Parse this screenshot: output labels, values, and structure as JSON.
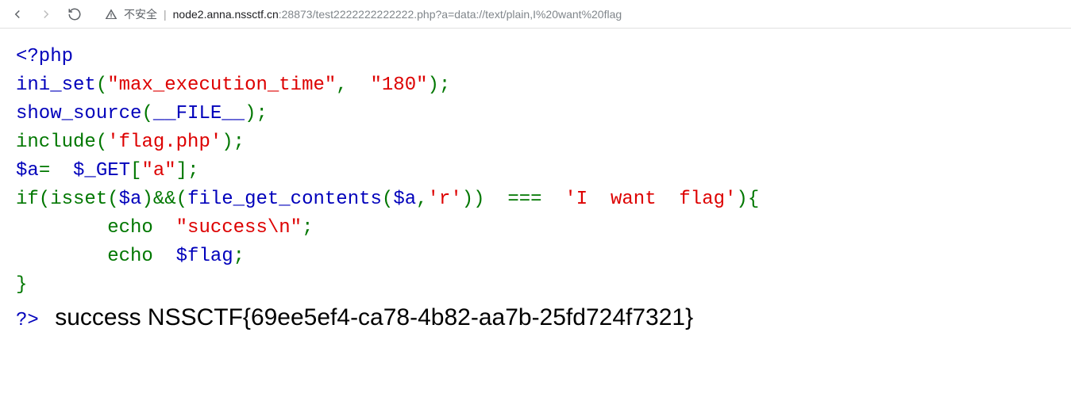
{
  "toolbar": {
    "insecure_label": "不安全",
    "pipe": "|",
    "url_host": "node2.anna.nssctf.cn",
    "url_port": ":28873",
    "url_path": "/test2222222222222.php?a=data://text/plain,I%20want%20flag"
  },
  "code": {
    "open_tag": "<?php",
    "l2_fn": "ini_set",
    "l2_p1": "(",
    "l2_s1": "\"max_execution_time\"",
    "l2_c1": ",  ",
    "l2_s2": "\"180\"",
    "l2_p2": ");",
    "l3_fn": "show_source",
    "l3_p1": "(",
    "l3_k1": "__FILE__",
    "l3_p2": ");",
    "l4_fn": "include",
    "l4_p1": "(",
    "l4_s1": "'flag.php'",
    "l4_p2": ");",
    "l5_v1": "$a",
    "l5_eq": "=  ",
    "l5_v2": "$_GET",
    "l5_b1": "[",
    "l5_s1": "\"a\"",
    "l5_b2": "];",
    "l6_if": "if(",
    "l6_isset": "isset",
    "l6_p1": "(",
    "l6_v1": "$a",
    "l6_p2": ")&&(",
    "l6_fn2": "file_get_contents",
    "l6_p3": "(",
    "l6_v2": "$a",
    "l6_c1": ",",
    "l6_s1": "'r'",
    "l6_p4": "))  ===  ",
    "l6_s2": "'I  want  flag'",
    "l6_p5": "){",
    "indent": "        ",
    "l7_echo": "echo  ",
    "l7_s1": "\"success\\n\"",
    "l7_p1": ";",
    "l8_echo": "echo  ",
    "l8_v1": "$flag",
    "l8_p1": ";",
    "l9_brace": "}",
    "close_tag": "?> "
  },
  "output": {
    "text": "success NSSCTF{69ee5ef4-ca78-4b82-aa7b-25fd724f7321}"
  }
}
